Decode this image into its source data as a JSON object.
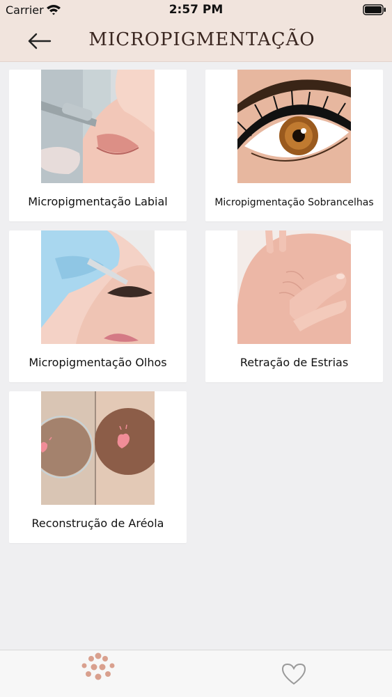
{
  "status_bar": {
    "carrier": "Carrier",
    "time": "2:57 PM"
  },
  "nav": {
    "title": "MICROPIGMENTAÇÃO",
    "back_icon": "arrow-left-icon"
  },
  "services": [
    {
      "label": "Micropigmentação  Labial"
    },
    {
      "label": "Micropigmentação Sobrancelhas"
    },
    {
      "label": "Micropigmentação Olhos"
    },
    {
      "label": "Retração de Estrias"
    },
    {
      "label": "Reconstrução de Aréola"
    }
  ],
  "tab_bar": {
    "tabs": [
      {
        "icon": "paw-icon",
        "active": true
      },
      {
        "icon": "heart-icon",
        "active": false
      }
    ]
  },
  "colors": {
    "header_bg": "#f1e4dd",
    "page_bg": "#efeff1",
    "accent": "#d9a08e"
  }
}
